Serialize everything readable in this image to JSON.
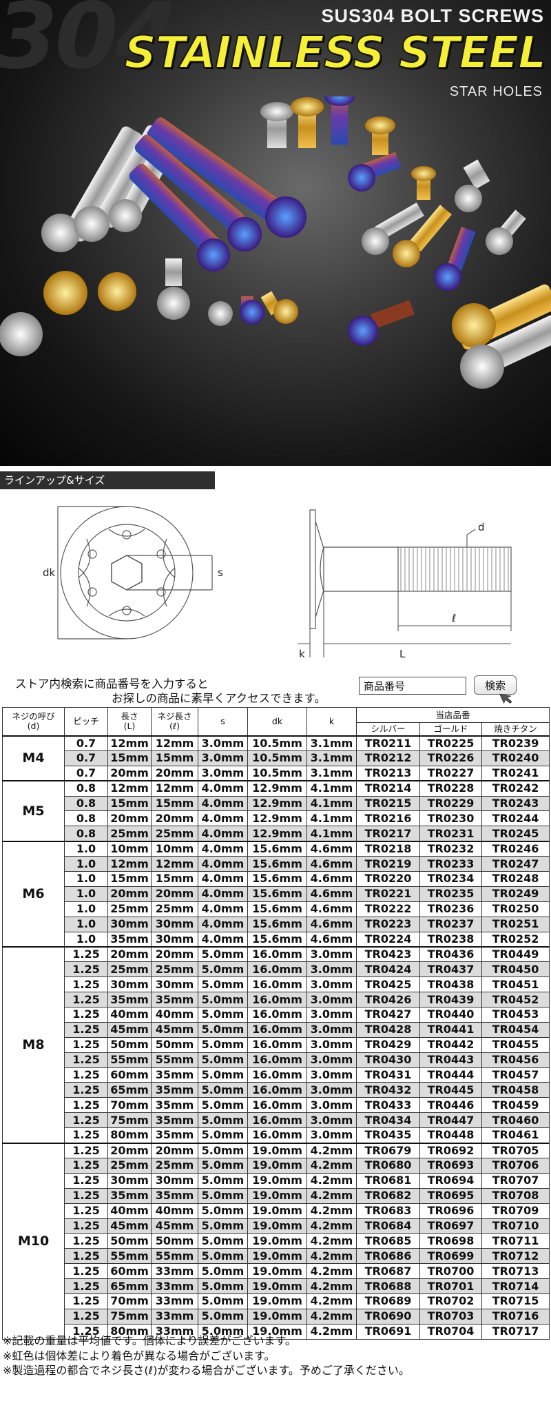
{
  "hero": {
    "big_text": "304",
    "subtitle": "SUS304 BOLT SCREWS",
    "title": "STAINLESS STEEL",
    "tagline": "STAR HOLES"
  },
  "section_label": "ラインアップ&サイズ",
  "diagram": {
    "dk": "dk",
    "s": "s",
    "d": "d",
    "l_small": "ℓ",
    "k": "k",
    "L": "L"
  },
  "search": {
    "text_line1": "ストア内検索に商品番号を入力すると",
    "text_line2": "お探しの商品に素早くアクセスできます。",
    "input_value": "商品番号",
    "button_label": "検索"
  },
  "table": {
    "headers": {
      "size": "ネジの呼び\n(d)",
      "pitch": "ピッチ",
      "length": "長さ\n(L)",
      "thread": "ネジ長さ\n(ℓ)",
      "s": "s",
      "dk": "dk",
      "k": "k",
      "part_no": "当店品番",
      "silver": "シルバー",
      "gold": "ゴールド",
      "titanium": "焼きチタン"
    },
    "groups": [
      {
        "size": "M4",
        "rows": [
          [
            "0.7",
            "12mm",
            "12mm",
            "3.0mm",
            "10.5mm",
            "3.1mm",
            "TR0211",
            "TR0225",
            "TR0239"
          ],
          [
            "0.7",
            "15mm",
            "15mm",
            "3.0mm",
            "10.5mm",
            "3.1mm",
            "TR0212",
            "TR0226",
            "TR0240"
          ],
          [
            "0.7",
            "20mm",
            "20mm",
            "3.0mm",
            "10.5mm",
            "3.1mm",
            "TR0213",
            "TR0227",
            "TR0241"
          ]
        ]
      },
      {
        "size": "M5",
        "rows": [
          [
            "0.8",
            "12mm",
            "12mm",
            "4.0mm",
            "12.9mm",
            "4.1mm",
            "TR0214",
            "TR0228",
            "TR0242"
          ],
          [
            "0.8",
            "15mm",
            "15mm",
            "4.0mm",
            "12.9mm",
            "4.1mm",
            "TR0215",
            "TR0229",
            "TR0243"
          ],
          [
            "0.8",
            "20mm",
            "20mm",
            "4.0mm",
            "12.9mm",
            "4.1mm",
            "TR0216",
            "TR0230",
            "TR0244"
          ],
          [
            "0.8",
            "25mm",
            "25mm",
            "4.0mm",
            "12.9mm",
            "4.1mm",
            "TR0217",
            "TR0231",
            "TR0245"
          ]
        ]
      },
      {
        "size": "M6",
        "rows": [
          [
            "1.0",
            "10mm",
            "10mm",
            "4.0mm",
            "15.6mm",
            "4.6mm",
            "TR0218",
            "TR0232",
            "TR0246"
          ],
          [
            "1.0",
            "12mm",
            "12mm",
            "4.0mm",
            "15.6mm",
            "4.6mm",
            "TR0219",
            "TR0233",
            "TR0247"
          ],
          [
            "1.0",
            "15mm",
            "15mm",
            "4.0mm",
            "15.6mm",
            "4.6mm",
            "TR0220",
            "TR0234",
            "TR0248"
          ],
          [
            "1.0",
            "20mm",
            "20mm",
            "4.0mm",
            "15.6mm",
            "4.6mm",
            "TR0221",
            "TR0235",
            "TR0249"
          ],
          [
            "1.0",
            "25mm",
            "25mm",
            "4.0mm",
            "15.6mm",
            "4.6mm",
            "TR0222",
            "TR0236",
            "TR0250"
          ],
          [
            "1.0",
            "30mm",
            "30mm",
            "4.0mm",
            "15.6mm",
            "4.6mm",
            "TR0223",
            "TR0237",
            "TR0251"
          ],
          [
            "1.0",
            "35mm",
            "30mm",
            "4.0mm",
            "15.6mm",
            "4.6mm",
            "TR0224",
            "TR0238",
            "TR0252"
          ]
        ]
      },
      {
        "size": "M8",
        "rows": [
          [
            "1.25",
            "20mm",
            "20mm",
            "5.0mm",
            "16.0mm",
            "3.0mm",
            "TR0423",
            "TR0436",
            "TR0449"
          ],
          [
            "1.25",
            "25mm",
            "25mm",
            "5.0mm",
            "16.0mm",
            "3.0mm",
            "TR0424",
            "TR0437",
            "TR0450"
          ],
          [
            "1.25",
            "30mm",
            "30mm",
            "5.0mm",
            "16.0mm",
            "3.0mm",
            "TR0425",
            "TR0438",
            "TR0451"
          ],
          [
            "1.25",
            "35mm",
            "35mm",
            "5.0mm",
            "16.0mm",
            "3.0mm",
            "TR0426",
            "TR0439",
            "TR0452"
          ],
          [
            "1.25",
            "40mm",
            "40mm",
            "5.0mm",
            "16.0mm",
            "3.0mm",
            "TR0427",
            "TR0440",
            "TR0453"
          ],
          [
            "1.25",
            "45mm",
            "45mm",
            "5.0mm",
            "16.0mm",
            "3.0mm",
            "TR0428",
            "TR0441",
            "TR0454"
          ],
          [
            "1.25",
            "50mm",
            "50mm",
            "5.0mm",
            "16.0mm",
            "3.0mm",
            "TR0429",
            "TR0442",
            "TR0455"
          ],
          [
            "1.25",
            "55mm",
            "55mm",
            "5.0mm",
            "16.0mm",
            "3.0mm",
            "TR0430",
            "TR0443",
            "TR0456"
          ],
          [
            "1.25",
            "60mm",
            "35mm",
            "5.0mm",
            "16.0mm",
            "3.0mm",
            "TR0431",
            "TR0444",
            "TR0457"
          ],
          [
            "1.25",
            "65mm",
            "35mm",
            "5.0mm",
            "16.0mm",
            "3.0mm",
            "TR0432",
            "TR0445",
            "TR0458"
          ],
          [
            "1.25",
            "70mm",
            "35mm",
            "5.0mm",
            "16.0mm",
            "3.0mm",
            "TR0433",
            "TR0446",
            "TR0459"
          ],
          [
            "1.25",
            "75mm",
            "35mm",
            "5.0mm",
            "16.0mm",
            "3.0mm",
            "TR0434",
            "TR0447",
            "TR0460"
          ],
          [
            "1.25",
            "80mm",
            "35mm",
            "5.0mm",
            "16.0mm",
            "3.0mm",
            "TR0435",
            "TR0448",
            "TR0461"
          ]
        ]
      },
      {
        "size": "M10",
        "rows": [
          [
            "1.25",
            "20mm",
            "20mm",
            "5.0mm",
            "19.0mm",
            "4.2mm",
            "TR0679",
            "TR0692",
            "TR0705"
          ],
          [
            "1.25",
            "25mm",
            "25mm",
            "5.0mm",
            "19.0mm",
            "4.2mm",
            "TR0680",
            "TR0693",
            "TR0706"
          ],
          [
            "1.25",
            "30mm",
            "30mm",
            "5.0mm",
            "19.0mm",
            "4.2mm",
            "TR0681",
            "TR0694",
            "TR0707"
          ],
          [
            "1.25",
            "35mm",
            "35mm",
            "5.0mm",
            "19.0mm",
            "4.2mm",
            "TR0682",
            "TR0695",
            "TR0708"
          ],
          [
            "1.25",
            "40mm",
            "40mm",
            "5.0mm",
            "19.0mm",
            "4.2mm",
            "TR0683",
            "TR0696",
            "TR0709"
          ],
          [
            "1.25",
            "45mm",
            "45mm",
            "5.0mm",
            "19.0mm",
            "4.2mm",
            "TR0684",
            "TR0697",
            "TR0710"
          ],
          [
            "1.25",
            "50mm",
            "50mm",
            "5.0mm",
            "19.0mm",
            "4.2mm",
            "TR0685",
            "TR0698",
            "TR0711"
          ],
          [
            "1.25",
            "55mm",
            "55mm",
            "5.0mm",
            "19.0mm",
            "4.2mm",
            "TR0686",
            "TR0699",
            "TR0712"
          ],
          [
            "1.25",
            "60mm",
            "33mm",
            "5.0mm",
            "19.0mm",
            "4.2mm",
            "TR0687",
            "TR0700",
            "TR0713"
          ],
          [
            "1.25",
            "65mm",
            "33mm",
            "5.0mm",
            "19.0mm",
            "4.2mm",
            "TR0688",
            "TR0701",
            "TR0714"
          ],
          [
            "1.25",
            "70mm",
            "33mm",
            "5.0mm",
            "19.0mm",
            "4.2mm",
            "TR0689",
            "TR0702",
            "TR0715"
          ],
          [
            "1.25",
            "75mm",
            "33mm",
            "5.0mm",
            "19.0mm",
            "4.2mm",
            "TR0690",
            "TR0703",
            "TR0716"
          ],
          [
            "1.25",
            "80mm",
            "33mm",
            "5.0mm",
            "19.0mm",
            "4.2mm",
            "TR0691",
            "TR0704",
            "TR0717"
          ]
        ]
      }
    ]
  },
  "notes": [
    "※記載の重量は平均値です。個体により誤差がございます。",
    "※虹色は個体差により着色が異なる場合がございます。",
    "※製造過程の都合でネジ長さ(ℓ)が変わる場合がございます。予めご了承ください。"
  ],
  "colors": {
    "title_yellow": "#f6ef3a",
    "section_bar": "#2f2f2f",
    "row_alt": "#dcdcdc"
  }
}
